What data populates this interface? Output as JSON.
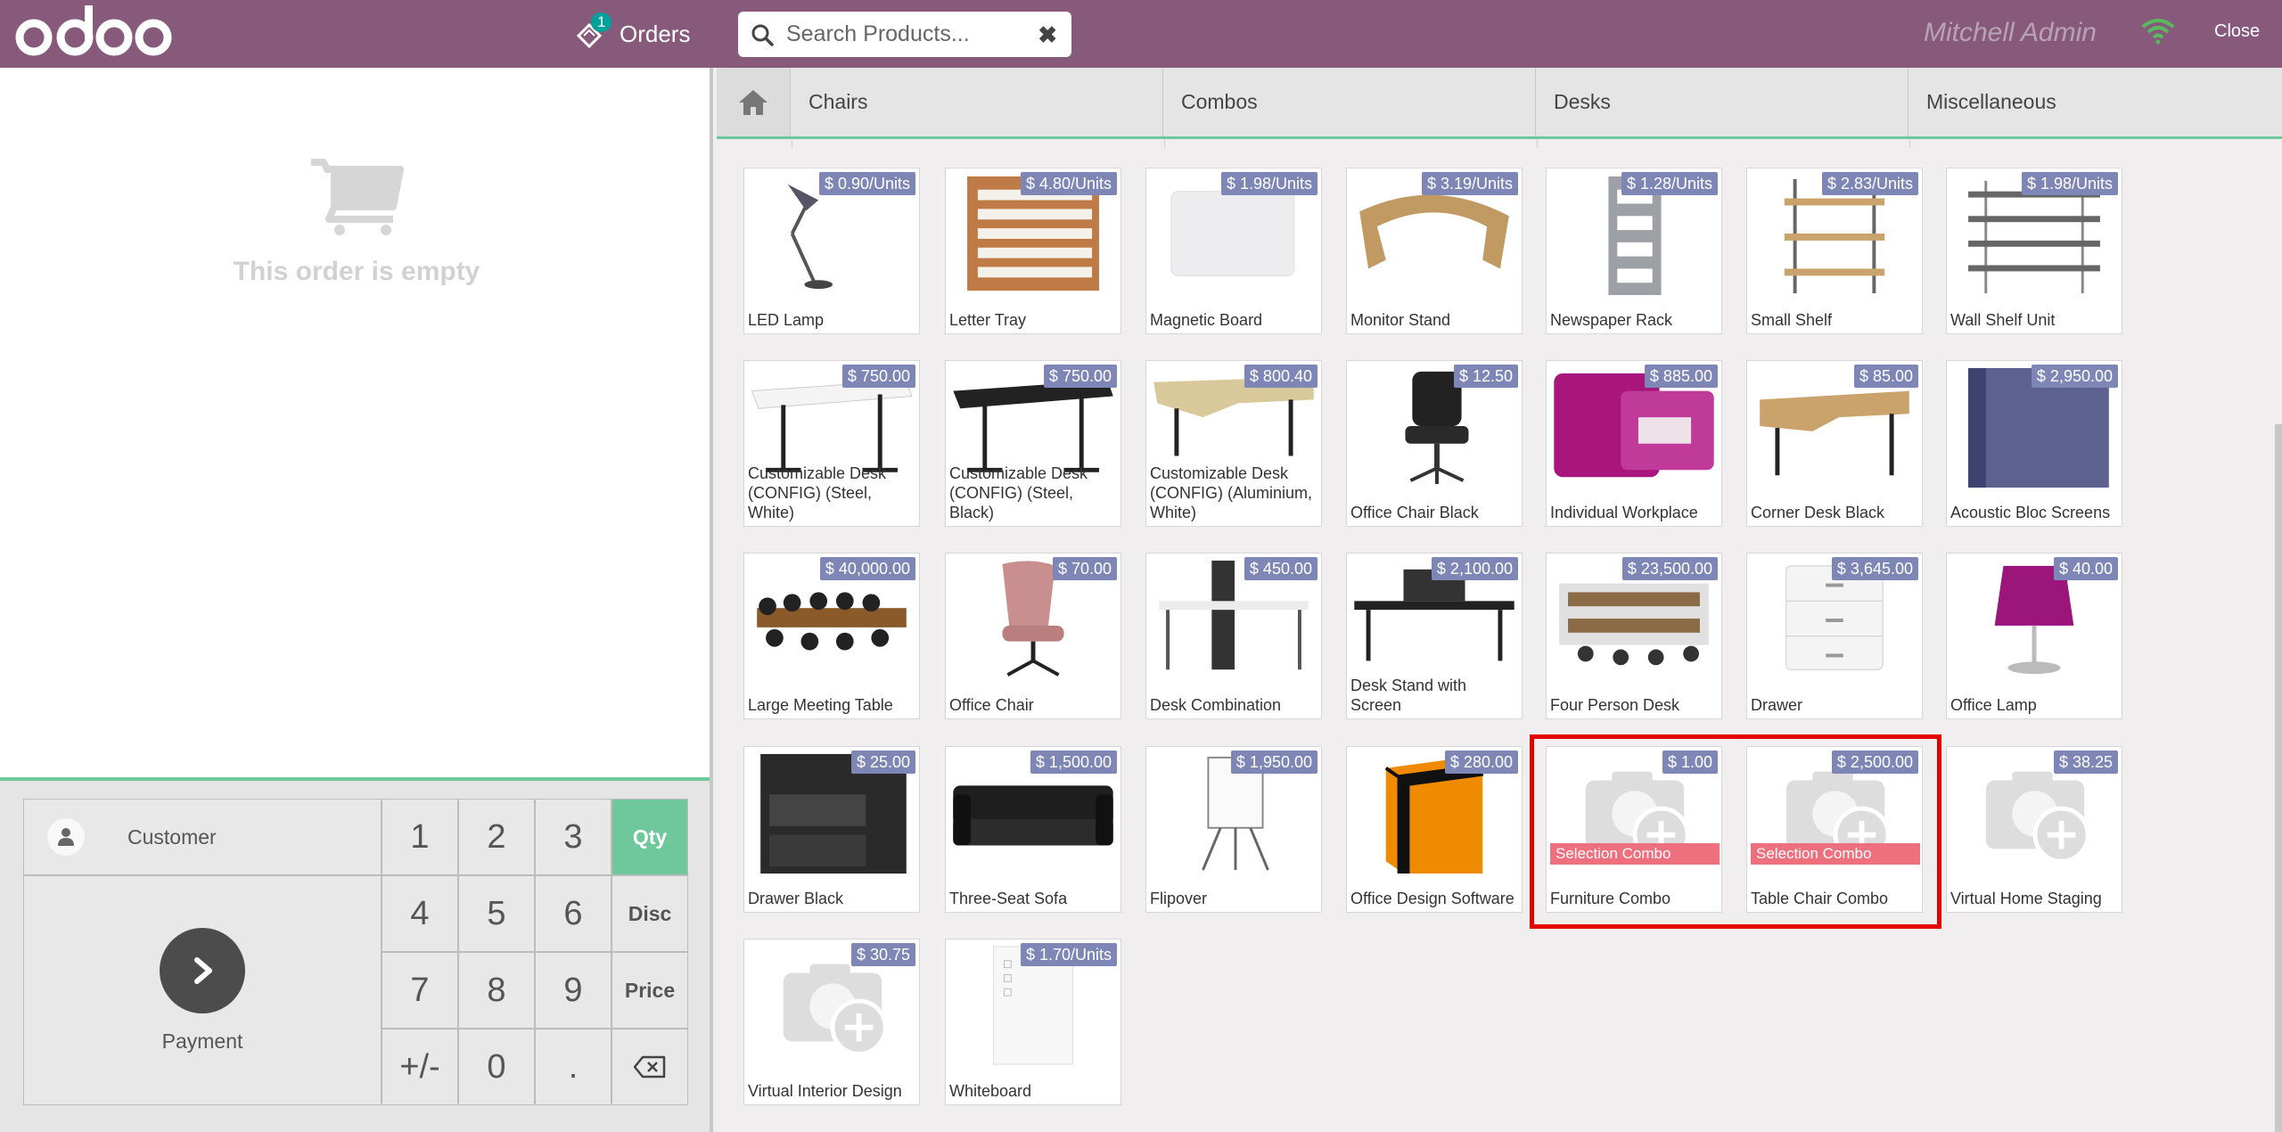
{
  "header": {
    "orders_label": "Orders",
    "orders_count": "1",
    "search_placeholder": "Search Products...",
    "user_name": "Mitchell Admin",
    "close_label": "Close"
  },
  "order": {
    "empty_text": "This order is empty"
  },
  "numpad": {
    "customer_label": "Customer",
    "payment_label": "Payment",
    "keys": [
      "1",
      "2",
      "3",
      "4",
      "5",
      "6",
      "7",
      "8",
      "9",
      "+/-",
      "0",
      "."
    ],
    "qty_label": "Qty",
    "disc_label": "Disc",
    "price_label": "Price"
  },
  "categories": [
    "Chairs",
    "Combos",
    "Desks",
    "Miscellaneous"
  ],
  "products": [
    {
      "name": "LED Lamp",
      "price": "$ 0.90/Units",
      "icon": "lamp"
    },
    {
      "name": "Letter Tray",
      "price": "$ 4.80/Units",
      "icon": "tray"
    },
    {
      "name": "Magnetic Board",
      "price": "$ 1.98/Units",
      "icon": "board"
    },
    {
      "name": "Monitor Stand",
      "price": "$ 3.19/Units",
      "icon": "stand"
    },
    {
      "name": "Newspaper Rack",
      "price": "$ 1.28/Units",
      "icon": "rack"
    },
    {
      "name": "Small Shelf",
      "price": "$ 2.83/Units",
      "icon": "shelf"
    },
    {
      "name": "Wall Shelf Unit",
      "price": "$ 1.98/Units",
      "icon": "wallshelf"
    },
    {
      "name": "Customizable Desk (CONFIG) (Steel, White)",
      "price": "$ 750.00",
      "icon": "desk-white"
    },
    {
      "name": "Customizable Desk (CONFIG) (Steel, Black)",
      "price": "$ 750.00",
      "icon": "desk-black"
    },
    {
      "name": "Customizable Desk (CONFIG) (Aluminium, White)",
      "price": "$ 800.40",
      "icon": "desk-wood"
    },
    {
      "name": "Office Chair Black",
      "price": "$ 12.50",
      "icon": "chair-black"
    },
    {
      "name": "Individual Workplace",
      "price": "$ 885.00",
      "icon": "workplace"
    },
    {
      "name": "Corner Desk Black",
      "price": "$ 85.00",
      "icon": "corner-desk"
    },
    {
      "name": "Acoustic Bloc Screens",
      "price": "$ 2,950.00",
      "icon": "screen"
    },
    {
      "name": "Large Meeting Table",
      "price": "$ 40,000.00",
      "icon": "meeting"
    },
    {
      "name": "Office Chair",
      "price": "$ 70.00",
      "icon": "chair-pink"
    },
    {
      "name": "Desk Combination",
      "price": "$ 450.00",
      "icon": "desk-combo"
    },
    {
      "name": "Desk Stand with Screen",
      "price": "$ 2,100.00",
      "icon": "desk-screen"
    },
    {
      "name": "Four Person Desk",
      "price": "$ 23,500.00",
      "icon": "four-desk"
    },
    {
      "name": "Drawer",
      "price": "$ 3,645.00",
      "icon": "drawer"
    },
    {
      "name": "Office Lamp",
      "price": "$ 40.00",
      "icon": "office-lamp"
    },
    {
      "name": "Drawer Black",
      "price": "$ 25.00",
      "icon": "drawer-black"
    },
    {
      "name": "Three-Seat Sofa",
      "price": "$ 1,500.00",
      "icon": "sofa"
    },
    {
      "name": "Flipover",
      "price": "$ 1,950.00",
      "icon": "flipover"
    },
    {
      "name": "Office Design Software",
      "price": "$ 280.00",
      "icon": "software"
    },
    {
      "name": "Furniture Combo",
      "price": "$ 1.00",
      "icon": "placeholder",
      "tag": "Selection Combo"
    },
    {
      "name": "Table Chair Combo",
      "price": "$ 2,500.00",
      "icon": "placeholder",
      "tag": "Selection Combo"
    },
    {
      "name": "Virtual Home Staging",
      "price": "$ 38.25",
      "icon": "placeholder"
    },
    {
      "name": "Virtual Interior Design",
      "price": "$ 30.75",
      "icon": "placeholder"
    },
    {
      "name": "Whiteboard",
      "price": "$ 1.70/Units",
      "icon": "whiteboard"
    }
  ],
  "colors": {
    "brand": "#875a7b",
    "accent": "#6ec89b",
    "price_badge": "#7e86b6",
    "combo_tag": "#ee6f7e",
    "highlight": "#e30000"
  }
}
